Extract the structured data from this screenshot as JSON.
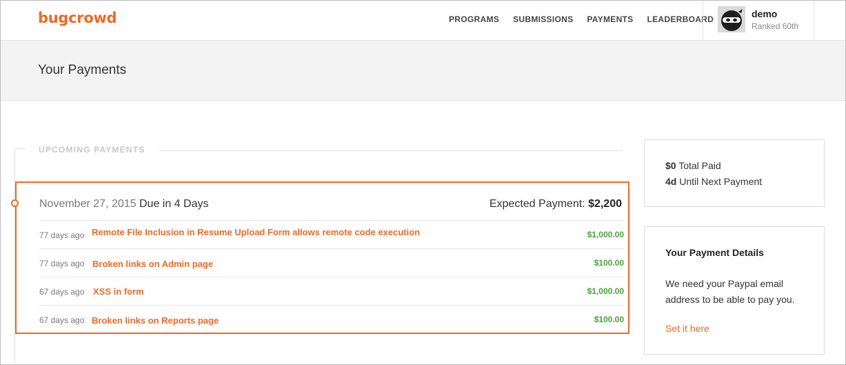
{
  "header": {
    "logo": "bugcrowd",
    "nav": [
      "PROGRAMS",
      "SUBMISSIONS",
      "PAYMENTS",
      "LEADERBOARD"
    ],
    "user": {
      "name": "demo",
      "rank": "Ranked 60th"
    }
  },
  "page": {
    "title": "Your Payments"
  },
  "upcoming": {
    "label": "UPCOMING PAYMENTS",
    "group": {
      "date": "November 27, 2015",
      "due": "Due in 4 Days",
      "expected_label": "Expected Payment:",
      "expected_amount": "$2,200",
      "items": [
        {
          "ago": "77 days ago",
          "title": "Remote File Inclusion in Resume Upload Form allows remote code execution",
          "amount": "$1,000.00"
        },
        {
          "ago": "77 days ago",
          "title": "Broken links on Admin page",
          "amount": "$100.00"
        },
        {
          "ago": "67 days ago",
          "title": "XSS in form",
          "amount": "$1,000.00"
        },
        {
          "ago": "67 days ago",
          "title": "Broken links on Reports page",
          "amount": "$100.00"
        }
      ]
    }
  },
  "summary": {
    "total_paid_value": "$0",
    "total_paid_label": "Total Paid",
    "next_value": "4d",
    "next_label": "Until Next Payment"
  },
  "payment_details": {
    "title": "Your Payment Details",
    "message": "We need your Paypal email address to be able to pay you.",
    "link": "Set it here"
  },
  "colors": {
    "accent": "#f26822",
    "amount": "#4aa23a"
  }
}
